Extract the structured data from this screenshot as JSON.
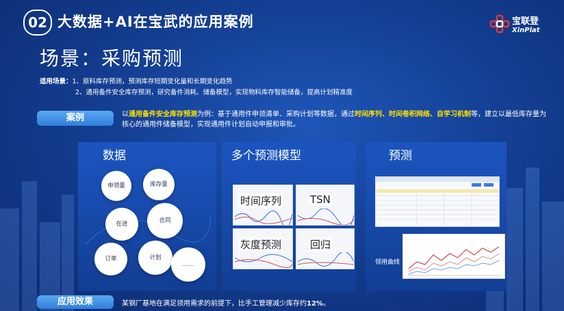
{
  "header": {
    "number": "02",
    "title": "大数据+AI在宝武的应用案例"
  },
  "logo": {
    "cn": "宝联登",
    "en": "XinPlat"
  },
  "scene_title": "场景：采购预测",
  "application": {
    "label": "适用场景：",
    "line1": "1、原料库存预测，预测库存短期变化量和长期变化趋势",
    "line2": "2、通用备件安全库存预测，研究备件消耗、储备模型，实现物料库存智能储备，提高计划精准度"
  },
  "case": {
    "label": "案例",
    "t1": "以",
    "h1": "通用备件安全库存预测",
    "t2": "为例：基于通用件申领清单、采购计划等数据，通过",
    "h2": "时间序列、时间卷积网络、自学习机制",
    "t3": "等，建立以最低库存量为核心的通用件储备模型，实现通用件计划自动申报和审批。"
  },
  "panels": {
    "data": {
      "title": "数据",
      "circles": [
        "申领量",
        "库存量",
        "在途",
        "合同",
        "订单",
        "计划",
        "……"
      ]
    },
    "models": {
      "title": "多个预测模型",
      "items": [
        "时间序列",
        "TSN",
        "灰度预测",
        "回归"
      ]
    },
    "forecast": {
      "title": "预测",
      "curve_label": "领用曲线"
    }
  },
  "effect": {
    "label": "应用效果",
    "text": "某钢厂基地在满足领用需求的前提下，比手工管理减少库存约",
    "percent": "12%",
    "end": "。"
  }
}
